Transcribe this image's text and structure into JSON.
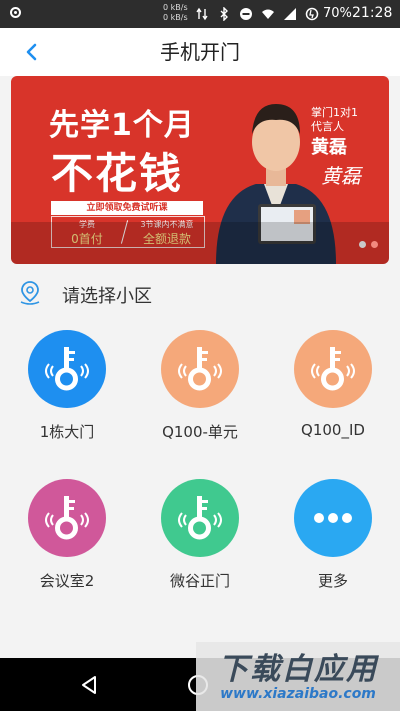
{
  "status_bar": {
    "network_up": "0 kB/s",
    "network_down": "0 kB/s",
    "battery": "70%",
    "time": "21:28"
  },
  "header": {
    "title": "手机开门"
  },
  "banner": {
    "slogan_line1": "先学1个月",
    "slogan_line2": "不花钱",
    "cta": "立即领取免费试听课",
    "fee_label": "学费",
    "fee_value": "0首付",
    "refund_label": "3节课内不满意",
    "refund_value": "全额退款",
    "rep_line1": "掌门1对1",
    "rep_line2": "代言人",
    "rep_name": "黄磊",
    "signature": "黄磊",
    "page_count": 2,
    "active_page": 2
  },
  "community": {
    "label": "请选择小区"
  },
  "doors": [
    {
      "name": "1栋大门",
      "icon": "key-icon",
      "color": "#1e8ff0"
    },
    {
      "name": "Q100-单元",
      "icon": "key-icon",
      "color": "#f5a87a"
    },
    {
      "name": "Q100_ID",
      "icon": "key-icon",
      "color": "#f5a87a"
    },
    {
      "name": "会议室2",
      "icon": "key-icon",
      "color": "#d0589a"
    },
    {
      "name": "微谷正门",
      "icon": "key-icon",
      "color": "#40c98f"
    },
    {
      "name": "更多",
      "icon": "more-icon",
      "color": "#2aa8f2"
    }
  ],
  "watermark": {
    "title": "下载白应用",
    "url": "www.xiazaibao.com"
  }
}
